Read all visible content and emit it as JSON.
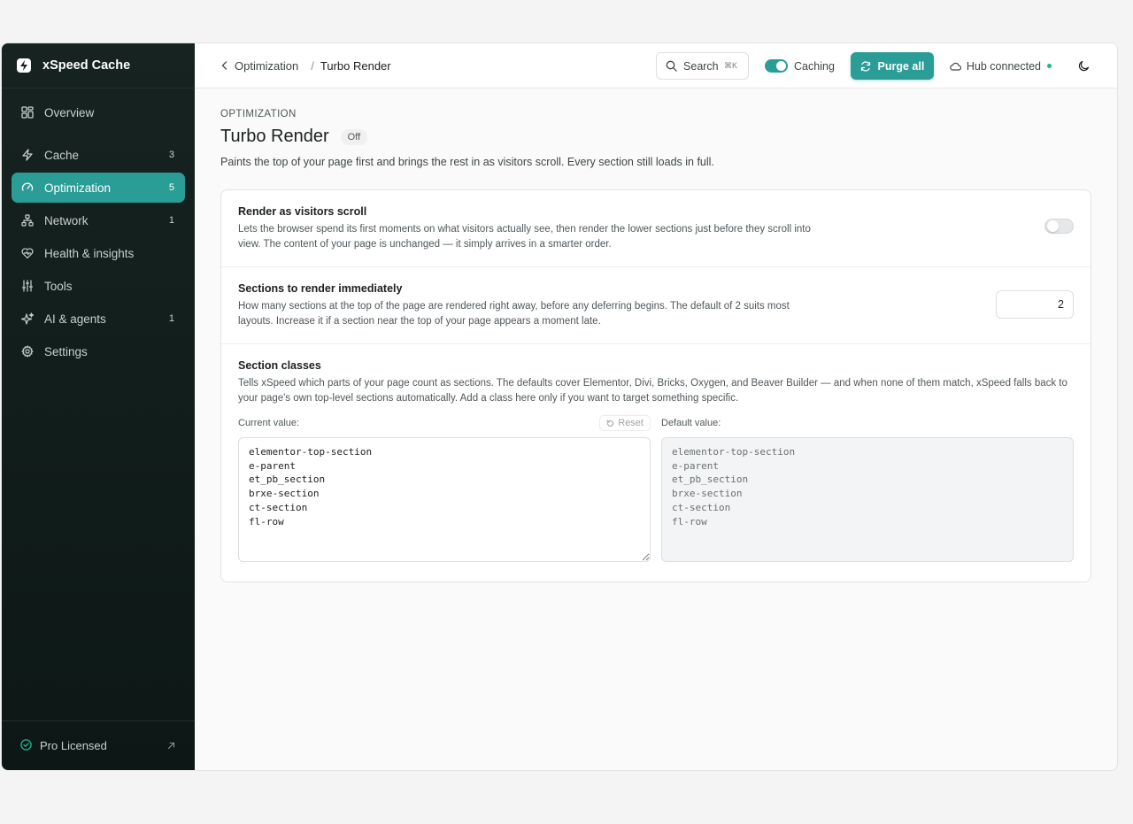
{
  "brand": {
    "name": "xSpeed Cache"
  },
  "sidebar": {
    "items": [
      {
        "label": "Overview",
        "count": "",
        "icon": "grid-icon"
      },
      {
        "label": "Cache",
        "count": "3",
        "icon": "bolt-icon"
      },
      {
        "label": "Optimization",
        "count": "5",
        "icon": "gauge-icon",
        "active": true
      },
      {
        "label": "Network",
        "count": "1",
        "icon": "network-icon"
      },
      {
        "label": "Health & insights",
        "count": "",
        "icon": "heart-pulse-icon"
      },
      {
        "label": "Tools",
        "count": "",
        "icon": "sliders-icon"
      },
      {
        "label": "AI & agents",
        "count": "1",
        "icon": "sparkle-icon"
      },
      {
        "label": "Settings",
        "count": "",
        "icon": "gear-icon"
      }
    ],
    "footer": {
      "label": "Pro Licensed"
    }
  },
  "topbar": {
    "breadcrumb_parent": "Optimization",
    "breadcrumb_sep": "/",
    "breadcrumb_current": "Turbo Render",
    "search_label": "Search",
    "search_shortcut": "⌘K",
    "caching_label": "Caching",
    "purge_label": "Purge all",
    "hub_label": "Hub connected"
  },
  "page": {
    "eyebrow": "OPTIMIZATION",
    "title": "Turbo Render",
    "status_badge": "Off",
    "description": "Paints the top of your page first and brings the rest in as visitors scroll. Every section still loads in full."
  },
  "settings": {
    "render_scroll": {
      "title": "Render as visitors scroll",
      "description": "Lets the browser spend its first moments on what visitors actually see, then render the lower sections just before they scroll into view. The content of your page is unchanged — it simply arrives in a smarter order.",
      "enabled": false
    },
    "sections_immediate": {
      "title": "Sections to render immediately",
      "description": "How many sections at the top of the page are rendered right away, before any deferring begins. The default of 2 suits most layouts. Increase it if a section near the top of your page appears a moment late.",
      "value": "2"
    },
    "section_classes": {
      "title": "Section classes",
      "description": "Tells xSpeed which parts of your page count as sections. The defaults cover Elementor, Divi, Bricks, Oxygen, and Beaver Builder — and when none of them match, xSpeed falls back to your page's own top-level sections automatically. Add a class here only if you want to target something specific.",
      "current_label": "Current value:",
      "reset_label": "Reset",
      "default_label": "Default value:",
      "current_value": "elementor-top-section\ne-parent\net_pb_section\nbrxe-section\nct-section\nfl-row",
      "default_value": "elementor-top-section\ne-parent\net_pb_section\nbrxe-section\nct-section\nfl-row"
    }
  },
  "colors": {
    "accent": "#2a9d96",
    "sidebar_bg": "#162321",
    "online": "#1fb58a"
  }
}
